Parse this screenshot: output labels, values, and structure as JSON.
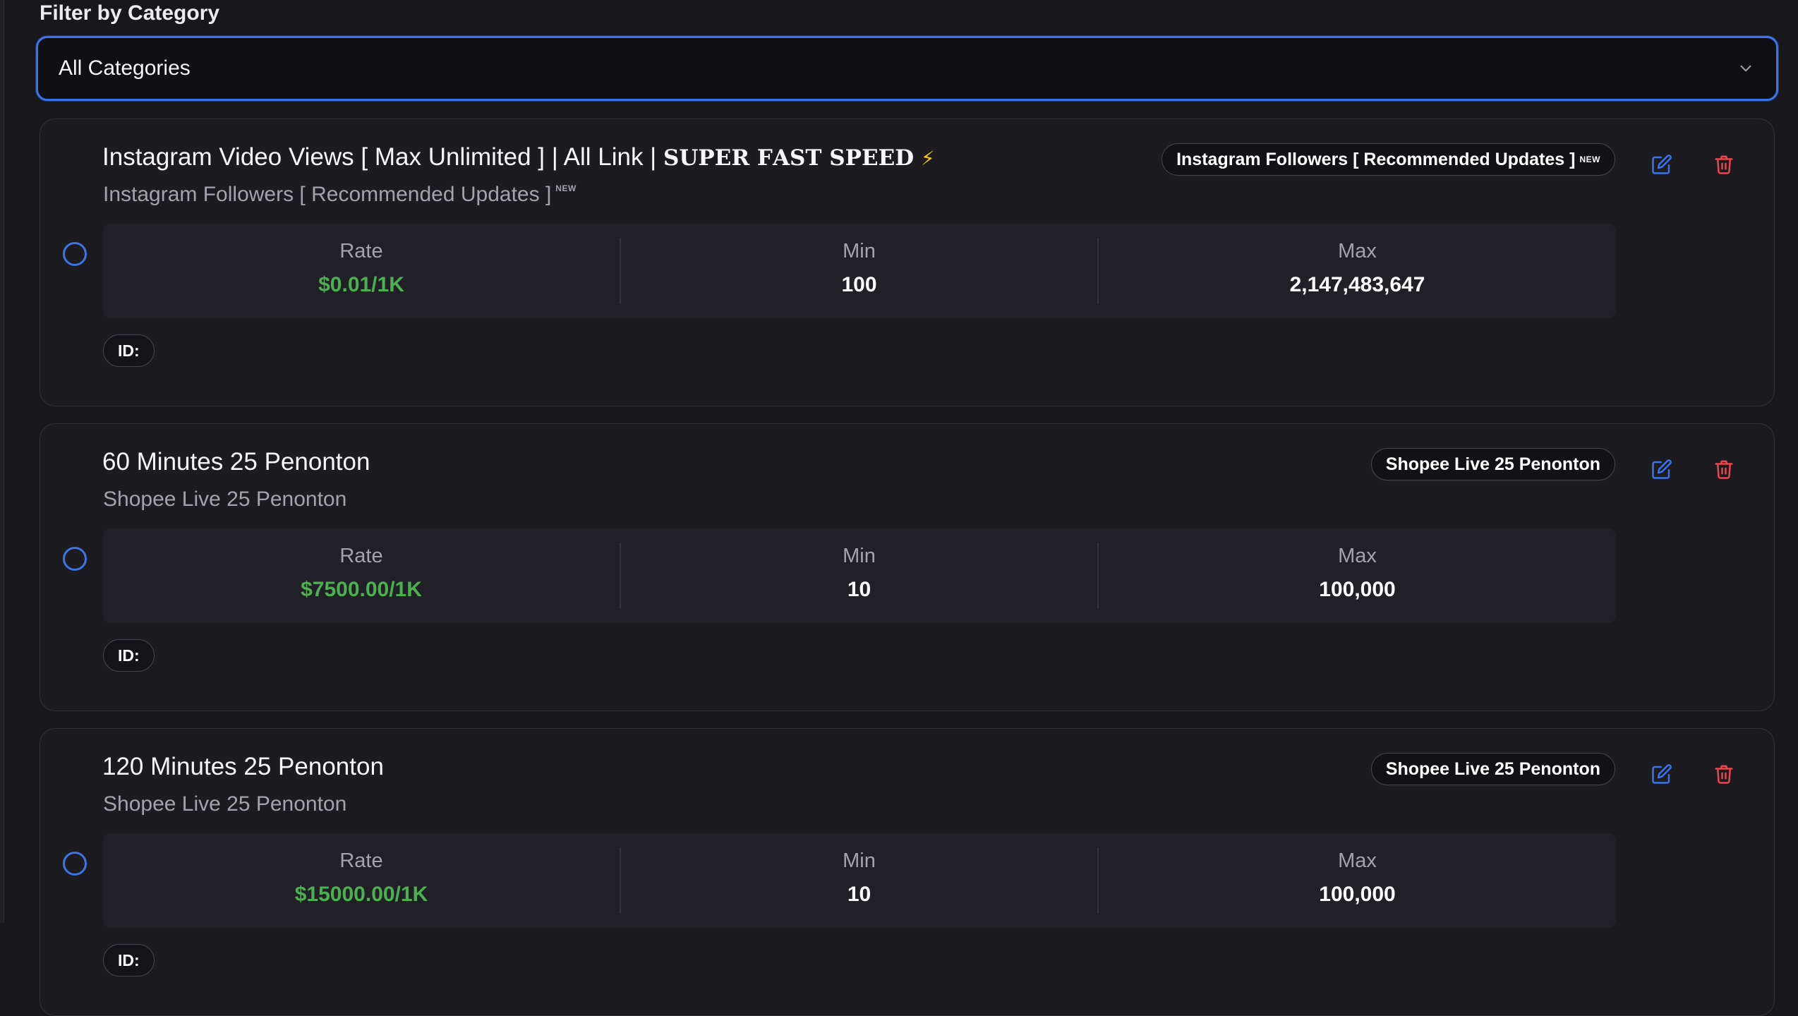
{
  "filter": {
    "label": "Filter by Category",
    "selected": "All Categories"
  },
  "services": [
    {
      "title": "Instagram Video Views [ Max Unlimited ] | All Link | ",
      "title_emphasis": "𝐒𝐔𝐏𝐄𝐑 𝐅𝐀𝐒𝐓 𝐒𝐏𝐄𝐄𝐃",
      "title_emoji": "⚡",
      "category": "Instagram Followers [ Recommended Updates ]",
      "category_tag": "NEW",
      "rate_label": "Rate",
      "rate": "$0.01/1K",
      "min_label": "Min",
      "min": "100",
      "max_label": "Max",
      "max": "2,147,483,647",
      "id_label": "ID:"
    },
    {
      "title": "60 Minutes 25 Penonton",
      "title_emphasis": "",
      "title_emoji": "",
      "category": "Shopee Live 25 Penonton",
      "category_tag": "",
      "rate_label": "Rate",
      "rate": "$7500.00/1K",
      "min_label": "Min",
      "min": "10",
      "max_label": "Max",
      "max": "100,000",
      "id_label": "ID:"
    },
    {
      "title": "120 Minutes 25 Penonton",
      "title_emphasis": "",
      "title_emoji": "",
      "category": "Shopee Live 25 Penonton",
      "category_tag": "",
      "rate_label": "Rate",
      "rate": "$15000.00/1K",
      "min_label": "Min",
      "min": "10",
      "max_label": "Max",
      "max": "100,000",
      "id_label": "ID:"
    }
  ],
  "colors": {
    "accent": "#3b74e8",
    "rate_green": "#4caf50",
    "delete_red": "#e5484d",
    "edit_blue": "#3b74e8"
  },
  "icons": {
    "select": "chevron-down-icon",
    "edit": "pencil-square-icon",
    "delete": "trash-icon",
    "radio": "radio-circle-icon"
  }
}
